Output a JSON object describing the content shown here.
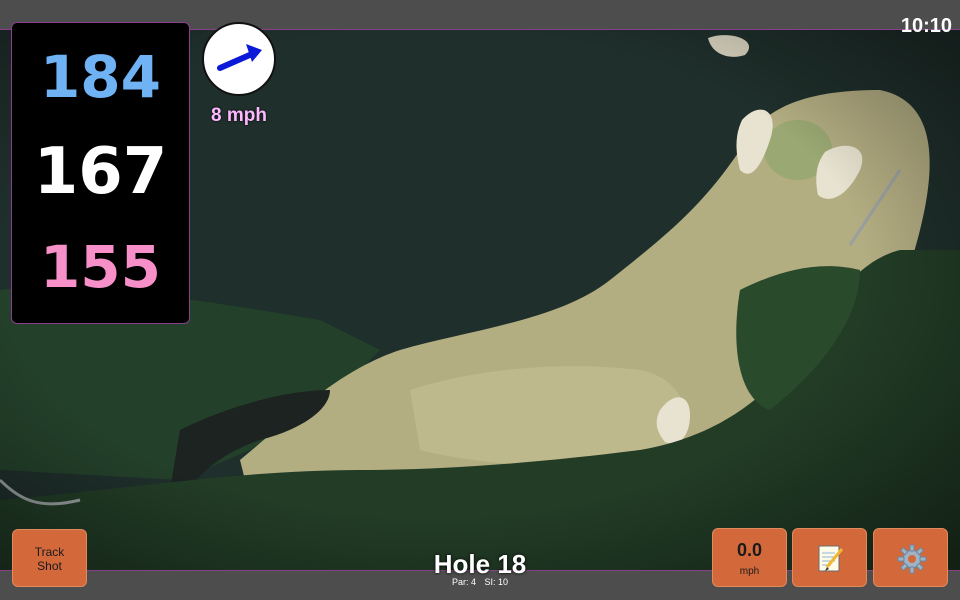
{
  "status": {
    "time": "10:10"
  },
  "distances": {
    "back": "184",
    "middle": "167",
    "front": "155"
  },
  "wind": {
    "speed": "8 mph",
    "icon": "wind-direction-arrow-icon"
  },
  "hole": {
    "title": "Hole 18",
    "par": "Par: 4",
    "si": "SI: 10"
  },
  "buttons": {
    "track_shot_line1": "Track",
    "track_shot_line2": "Shot",
    "speed_value": "0.0",
    "speed_unit": "mph",
    "notes_icon": "notepad-icon",
    "settings_icon": "gear-icon"
  },
  "colors": {
    "back_distance": "#6fb3f5",
    "middle_distance": "#ffffff",
    "front_distance": "#f78fc9",
    "wind_text": "#ffb8ff",
    "button": "#d3693b",
    "accent_border": "#8a3f8a"
  }
}
